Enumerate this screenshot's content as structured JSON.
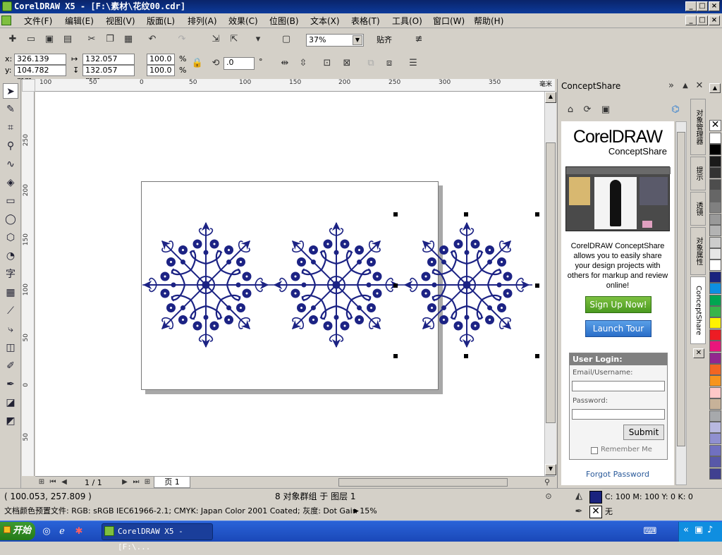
{
  "window": {
    "title": "CorelDRAW X5 - [F:\\素材\\花纹00.cdr]",
    "min": "_",
    "max": "□",
    "close": "×"
  },
  "menu": [
    "文件(F)",
    "编辑(E)",
    "视图(V)",
    "版面(L)",
    "排列(A)",
    "效果(C)",
    "位图(B)",
    "文本(X)",
    "表格(T)",
    "工具(O)",
    "窗口(W)",
    "帮助(H)"
  ],
  "toolbar": {
    "zoom": "37%",
    "snap_label": "贴齐"
  },
  "property_bar": {
    "x_label": "x:",
    "x": "326.139 mm",
    "y_label": "y:",
    "y": "104.782 mm",
    "w": "132.057 mm",
    "h": "132.057 mm",
    "scale_x": "100.0",
    "scale_y": "100.0",
    "pct": "%",
    "angle": ".0",
    "deg": "°"
  },
  "rulers": {
    "unit": "毫米",
    "h_ticks": [
      "100",
      "50",
      "0",
      "50",
      "100",
      "150",
      "200",
      "250",
      "300",
      "350"
    ],
    "v_ticks": [
      "250",
      "200",
      "150",
      "100",
      "50",
      "0",
      "50"
    ]
  },
  "page_nav": {
    "count": "1 / 1",
    "tab": "页 1"
  },
  "docker": {
    "title": "ConceptShare",
    "logo_main": "CorelDRAW",
    "logo_sub": "ConceptShare",
    "description": "CorelDRAW ConceptShare allows you to easily share your design projects with others for markup and review online!",
    "signup": "Sign Up Now!",
    "tour": "Launch Tour",
    "login_header": "User Login:",
    "email_label": "Email/Username:",
    "password_label": "Password:",
    "submit": "Submit",
    "remember": "Remember Me",
    "forgot": "Forgot Password",
    "side_tabs": [
      "对象管理器",
      "提示",
      "透镜",
      "对象属性",
      "ConceptShare"
    ]
  },
  "palette": [
    "#ffffff",
    "#000000",
    "#1a1a1a",
    "#333333",
    "#4d4d4d",
    "#666666",
    "#808080",
    "#999999",
    "#b3b3b3",
    "#cccccc",
    "#e6e6e6",
    "#ffffff",
    "#1a237e",
    "#0d8fe0",
    "#00a651",
    "#39b54a",
    "#fff200",
    "#ed1c24",
    "#e9167c",
    "#92278f",
    "#f26522",
    "#f7941d",
    "#ffc8c8",
    "#c7b299",
    "#a7a9ac",
    "#b8b8e0",
    "#9090d0",
    "#7070c0",
    "#5858a8",
    "#404090"
  ],
  "status": {
    "coords": "( 100.053, 257.809 )",
    "selection": "8 对象群组 于 图层 1",
    "profile": "文档颜色预置文件: RGB: sRGB IEC61966-2.1; CMYK: Japan Color 2001 Coated; 灰度: Dot Gain 15%",
    "fill": "C: 100 M: 100 Y: 0 K: 0",
    "outline": "无",
    "fill_color": "#1a237e"
  },
  "taskbar": {
    "start": "开始",
    "task": "CorelDRAW X5 - [F:\\..."
  },
  "ornament_color": "#1c2384"
}
